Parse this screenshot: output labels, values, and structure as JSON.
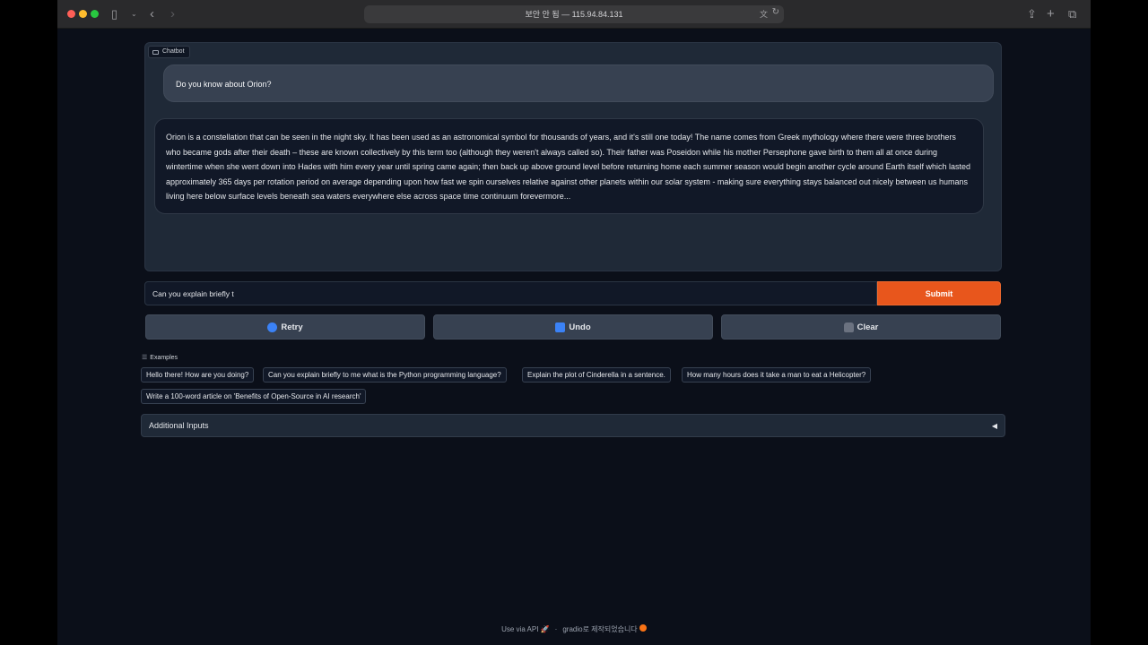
{
  "browser": {
    "url": "보안 안 됨 — 115.94.84.131"
  },
  "chatbot": {
    "label": "Chatbot",
    "user_message": "Do you know about Orion?",
    "bot_message": "Orion is a constellation that can be seen in the night sky. It has been used as an astronomical symbol for thousands of years, and it's still one today! The name comes from Greek mythology where there were three brothers who became gods after their death – these are known collectively by this term too (although they weren't always called so). Their father was Poseidon while his mother Persephone gave birth to them all at once during wintertime when she went down into Hades with him every year until spring came again; then back up above ground level before returning home each summer season would begin another cycle around Earth itself which lasted approximately 365 days per rotation period on average depending upon how fast we spin ourselves relative against other planets within our solar system - making sure everything stays balanced out nicely between us humans living here below surface levels beneath sea waters everywhere else across space time continuum forevermore..."
  },
  "input": {
    "value": "Can you explain briefly t",
    "submit_label": "Submit"
  },
  "actions": {
    "retry": "Retry",
    "undo": "Undo",
    "clear": "Clear"
  },
  "examples": {
    "label": "Examples",
    "items": [
      "Hello there! How are you doing?",
      "Can you explain briefly to me what is the Python programming language?",
      "Explain the plot of Cinderella in a sentence.",
      "How many hours does it take a man to eat a Helicopter?",
      "Write a 100-word article on 'Benefits of Open-Source in AI research'"
    ]
  },
  "accordion": {
    "label": "Additional Inputs",
    "caret": "◀"
  },
  "footer": {
    "api": "Use via API",
    "separator": "·",
    "built_with": "gradio로 제작되었습니다"
  },
  "colors": {
    "submit": "#e8561c",
    "background": "#0b0f19"
  }
}
